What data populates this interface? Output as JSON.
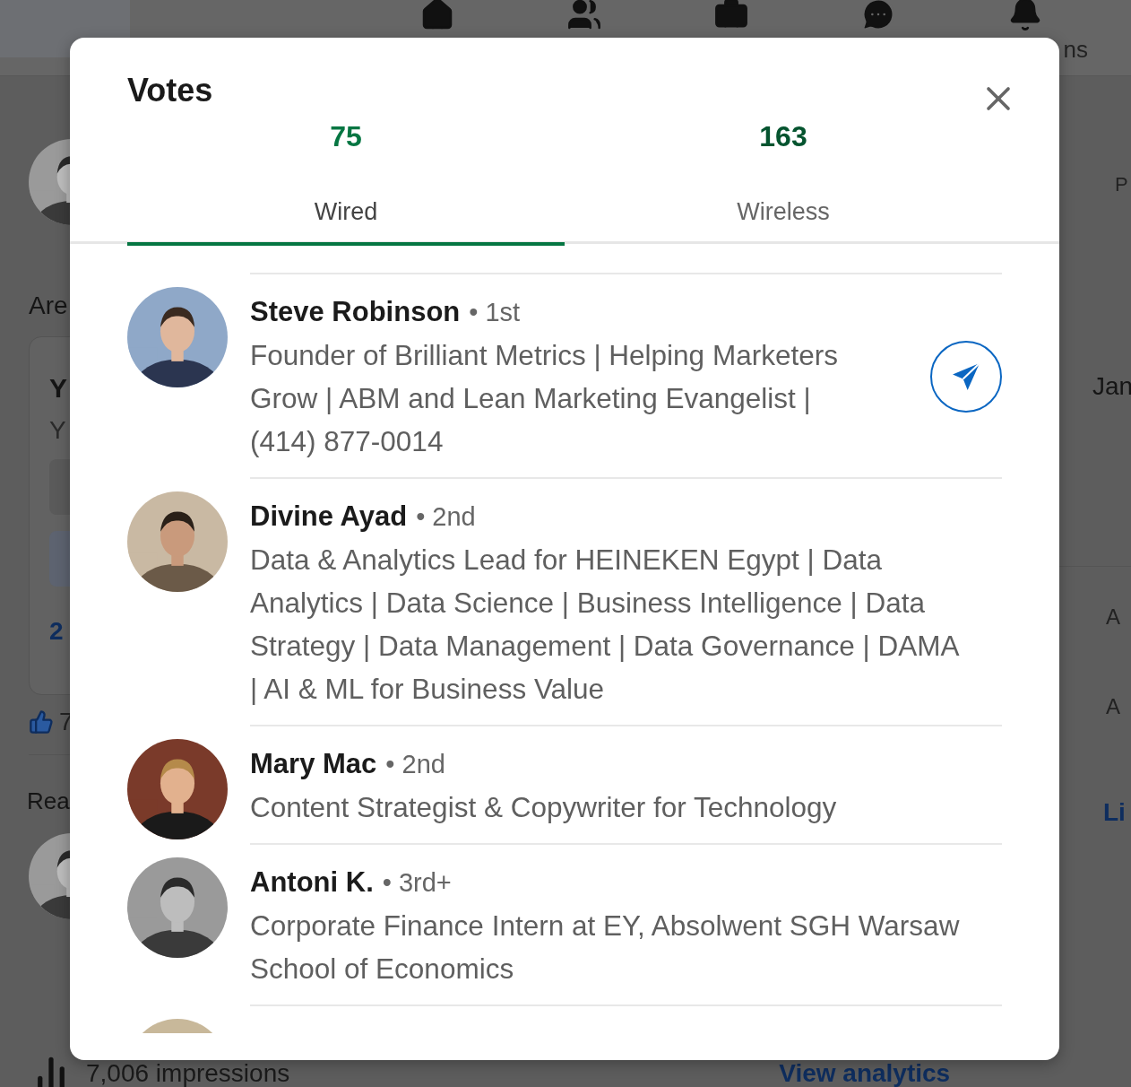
{
  "background": {
    "nav_text": "ns",
    "left": {
      "heading_1": "Are",
      "card_title": "Y",
      "card_text": "Y",
      "card_link": "2",
      "reactions": "7",
      "heading_2": "Rea"
    },
    "right": {
      "texts": [
        "P",
        "Jan",
        "A",
        "A"
      ],
      "link": "Li"
    },
    "footer": {
      "impressions": "7,006 impressions",
      "link": "View analytics"
    }
  },
  "modal": {
    "title": "Votes",
    "tabs": [
      {
        "count": "75",
        "label": "Wired",
        "selected": true
      },
      {
        "count": "163",
        "label": "Wireless",
        "selected": false
      }
    ],
    "voters": [
      {
        "kind": "person",
        "name": "Steve Robinson",
        "degree": "• 1st",
        "headline": "Founder of Brilliant Metrics | Helping Marketers Grow | ABM and Lean Marketing Evangelist | (414) 877-0014",
        "can_message": true
      },
      {
        "kind": "person",
        "name": "Divine Ayad",
        "degree": "• 2nd",
        "headline": "Data & Analytics Lead for HEINEKEN Egypt | Data Analytics | Data Science | Business Intelligence | Data Strategy | Data Management | Data Governance | DAMA | AI & ML for Business Value",
        "can_message": false
      },
      {
        "kind": "person",
        "name": "Mary Mac",
        "degree": "• 2nd",
        "headline": "Content Strategist & Copywriter for Technology",
        "can_message": false
      },
      {
        "kind": "person",
        "name": "Antoni K.",
        "degree": "• 3rd+",
        "headline": "Corporate Finance Intern at EY, Absolwent SGH Warsaw School of Economics",
        "can_message": false
      },
      {
        "kind": "partial"
      }
    ]
  }
}
